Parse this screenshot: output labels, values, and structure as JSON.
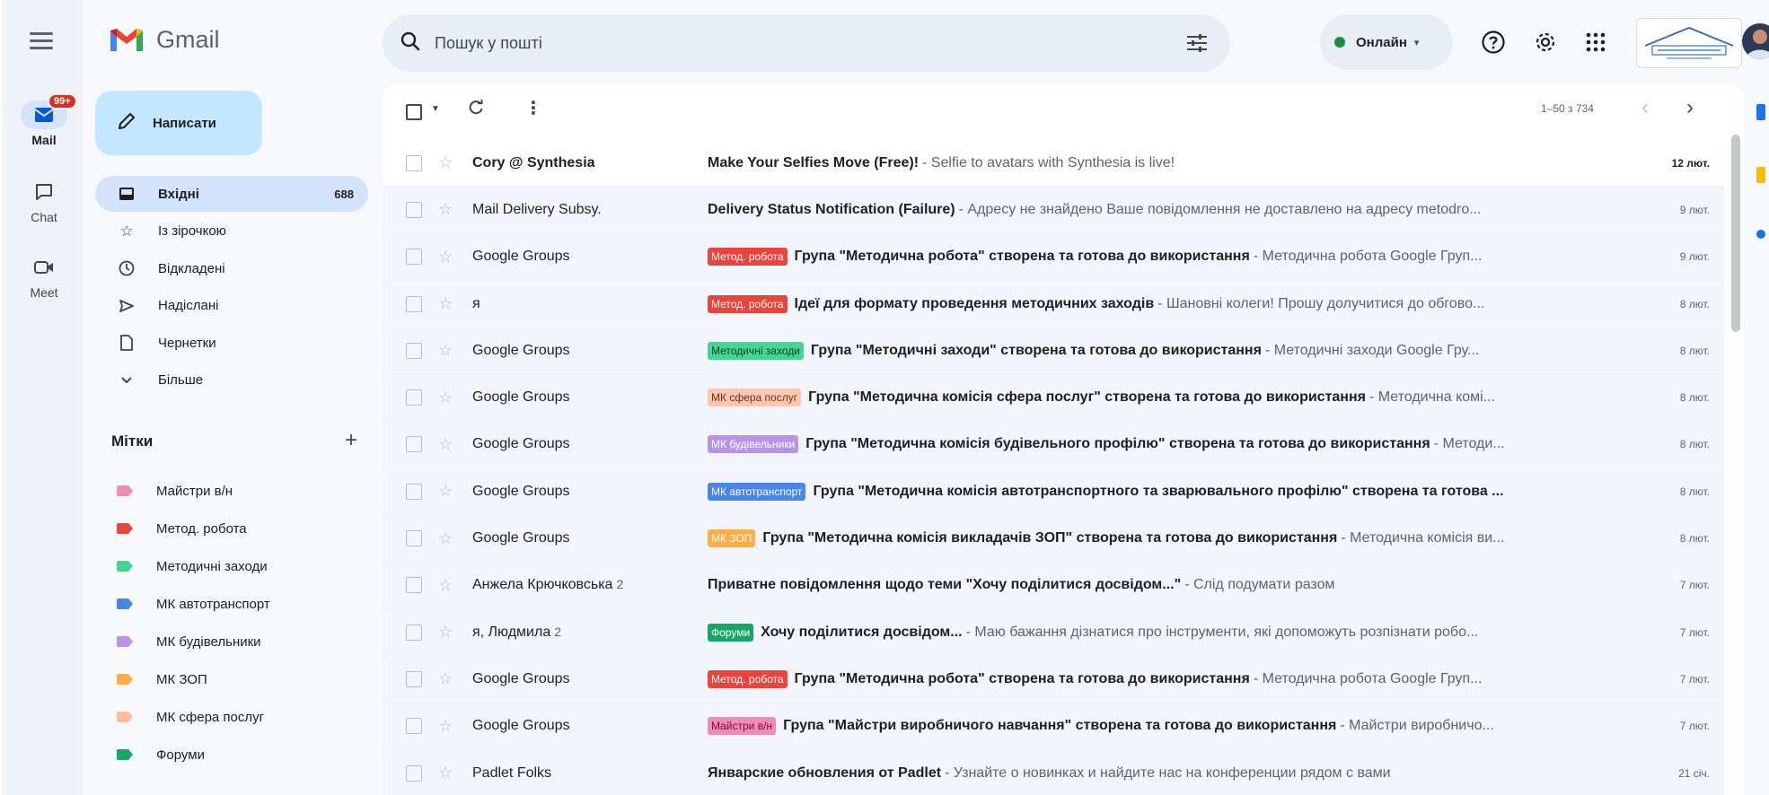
{
  "app": {
    "name": "Gmail"
  },
  "rail": {
    "items": [
      {
        "label": "Mail",
        "badge": "99+"
      },
      {
        "label": "Chat"
      },
      {
        "label": "Meet"
      }
    ]
  },
  "compose": {
    "label": "Написати"
  },
  "nav": {
    "items": [
      {
        "label": "Вхідні",
        "count": "688",
        "icon": "inbox-icon"
      },
      {
        "label": "Із зірочкою",
        "icon": "star-icon"
      },
      {
        "label": "Відкладені",
        "icon": "clock-icon"
      },
      {
        "label": "Надіслані",
        "icon": "send-icon"
      },
      {
        "label": "Чернетки",
        "icon": "draft-icon"
      },
      {
        "label": "Більше",
        "icon": "chevron-down-icon"
      }
    ]
  },
  "labels": {
    "title": "Мітки",
    "add": "+",
    "items": [
      {
        "label": "Майстри в/н",
        "color": "#f28bb4"
      },
      {
        "label": "Метод. робота",
        "color": "#e8453c"
      },
      {
        "label": "Методичні заходи",
        "color": "#43d692"
      },
      {
        "label": "МК автотранспорт",
        "color": "#4a86e8"
      },
      {
        "label": "МК будівельники",
        "color": "#b694e8"
      },
      {
        "label": "МК ЗОП",
        "color": "#ffad47"
      },
      {
        "label": "МК сфера послуг",
        "color": "#ffbc9f"
      },
      {
        "label": "Форуми",
        "color": "#16a765"
      }
    ]
  },
  "search": {
    "placeholder": "Пошук у пошті"
  },
  "status": {
    "label": "Онлайн"
  },
  "toolbar": {
    "pager": "1–50 з 734"
  },
  "emails": [
    {
      "sender": "Cory @ Synthesia",
      "count": "",
      "chip": "",
      "chip_bg": "",
      "chip_fg": "",
      "subject": "Make Your Selfies Move (Free)!",
      "snippet": "- Selfie to avatars with Synthesia is live!",
      "date": "12 лют.",
      "unread": true
    },
    {
      "sender": "Mail Delivery Subsy.",
      "count": "",
      "chip": "",
      "chip_bg": "",
      "chip_fg": "",
      "subject": "Delivery Status Notification (Failure)",
      "snippet": "- Адресу не знайдено Ваше повідомлення не доставлено на адресу metodro...",
      "date": "9 лют.",
      "unread": false
    },
    {
      "sender": "Google Groups",
      "count": "",
      "chip": "Метод. робота",
      "chip_bg": "#e8453c",
      "chip_fg": "#ffffff",
      "subject": "Група \"Методична робота\" створена та готова до використання",
      "snippet": "- Методична робота Google Груп...",
      "date": "9 лют.",
      "unread": false
    },
    {
      "sender": "я",
      "count": "",
      "chip": "Метод. робота",
      "chip_bg": "#e8453c",
      "chip_fg": "#ffffff",
      "subject": "Ідеї для формату проведення методичних заходів",
      "snippet": "- Шановні колеги! Прошу долучитися до обгово...",
      "date": "8 лют.",
      "unread": false
    },
    {
      "sender": "Google Groups",
      "count": "",
      "chip": "Методичні заходи",
      "chip_bg": "#43d692",
      "chip_fg": "#0b3d23",
      "subject": "Група \"Методичні заходи\" створена та готова до використання",
      "snippet": "- Методичні заходи Google Гру...",
      "date": "8 лют.",
      "unread": false
    },
    {
      "sender": "Google Groups",
      "count": "",
      "chip": "МК сфера послуг",
      "chip_bg": "#ffc8af",
      "chip_fg": "#7a2e0e",
      "subject": "Група \"Методична комісія сфера послуг\" створена та готова до використання",
      "snippet": "- Методична комі...",
      "date": "8 лют.",
      "unread": false
    },
    {
      "sender": "Google Groups",
      "count": "",
      "chip": "МК будівельники",
      "chip_bg": "#b694e8",
      "chip_fg": "#ffffff",
      "subject": "Група \"Методична комісія будівельного профілю\" створена та готова до використання",
      "snippet": "- Методи...",
      "date": "8 лют.",
      "unread": false
    },
    {
      "sender": "Google Groups",
      "count": "",
      "chip": "МК автотранспорт",
      "chip_bg": "#4a86e8",
      "chip_fg": "#ffffff",
      "subject": "Група \"Методична комісія автотранспортного та зварювального профілю\" створена та готова ...",
      "snippet": "",
      "date": "8 лют.",
      "unread": false
    },
    {
      "sender": "Google Groups",
      "count": "",
      "chip": "МК ЗОП",
      "chip_bg": "#ffad47",
      "chip_fg": "#ffffff",
      "subject": "Група \"Методична комісія викладачів ЗОП\" створена та готова до використання",
      "snippet": "- Методична комісія ви...",
      "date": "8 лют.",
      "unread": false
    },
    {
      "sender": "Анжела Крючковська",
      "count": "2",
      "chip": "",
      "chip_bg": "",
      "chip_fg": "",
      "subject": "Приватне повідомлення щодо теми \"Хочу поділитися досвідом...\"",
      "snippet": "- Слід подумати разом",
      "date": "7 лют.",
      "unread": false
    },
    {
      "sender": "я, Людмила",
      "count": "2",
      "chip": "Форуми",
      "chip_bg": "#16a765",
      "chip_fg": "#ffffff",
      "subject": "Хочу поділитися досвідом...",
      "snippet": "- Маю бажання дізнатися про інструменти, які допоможуть розпізнати робо...",
      "date": "7 лют.",
      "unread": false
    },
    {
      "sender": "Google Groups",
      "count": "",
      "chip": "Метод. робота",
      "chip_bg": "#e8453c",
      "chip_fg": "#ffffff",
      "subject": "Група \"Методична робота\" створена та готова до використання",
      "snippet": "- Методична робота Google Груп...",
      "date": "7 лют.",
      "unread": false
    },
    {
      "sender": "Google Groups",
      "count": "",
      "chip": "Майстри в/н",
      "chip_bg": "#f28bb4",
      "chip_fg": "#6b1239",
      "subject": "Група \"Майстри виробничого навчання\" створена та готова до використання",
      "snippet": "- Майстри виробничо...",
      "date": "7 лют.",
      "unread": false
    },
    {
      "sender": "Padlet Folks",
      "count": "",
      "chip": "",
      "chip_bg": "",
      "chip_fg": "",
      "subject": "Январские обновления от Padlet",
      "snippet": "- Узнайте о новинках и найдите нас на конференции рядом с вами",
      "date": "21 січ.",
      "unread": false
    }
  ],
  "colors": {
    "background": "#f6f8fc",
    "compose": "#c2e7ff",
    "active_nav": "#d3e3fd",
    "online_dot": "#1e8e3e",
    "badge": "#d93025"
  }
}
